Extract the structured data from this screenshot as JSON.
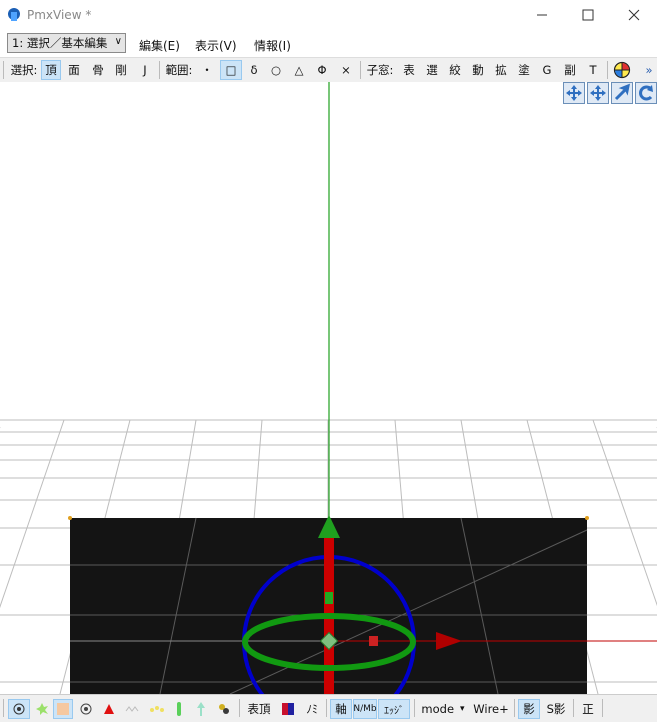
{
  "window": {
    "title": "PmxView *"
  },
  "menubar": {
    "mode_select": "1: 選択／基本編集",
    "items": [
      "編集(E)",
      "表示(V)",
      "情報(I)"
    ]
  },
  "toolbar": {
    "select_label": "選択:",
    "select_items": [
      "頂",
      "面",
      "骨",
      "剛",
      "J"
    ],
    "range_label": "範囲:",
    "range_items": [
      "・",
      "□",
      "δ",
      "○",
      "△",
      "Φ",
      "×"
    ],
    "child_label": "子窓:",
    "child_items": [
      "表",
      "選",
      "絞",
      "動",
      "拡",
      "塗",
      "G",
      "副",
      "T"
    ],
    "more": "»"
  },
  "statusbar": {
    "text_items": [
      "表頂",
      "ﾉﾐ",
      "軸",
      "N/Mb",
      "ｴｯｼﾞ",
      "mode",
      "Wire+",
      "影",
      "S影",
      "正"
    ],
    "mode_arrow": "▾"
  },
  "colors": {
    "axis_y": "#1fa01f",
    "axis_x": "#c00000",
    "gizmo_blue": "#0000cc",
    "gizmo_green": "#119911",
    "panel": "#111111"
  }
}
